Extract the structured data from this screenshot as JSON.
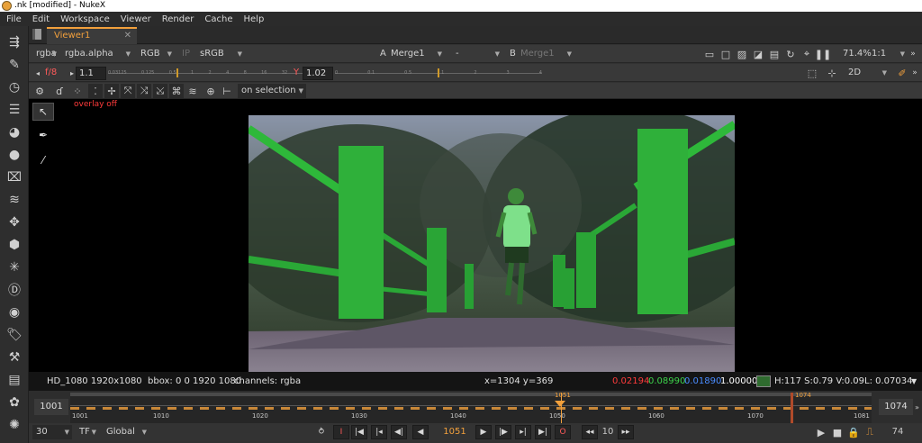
{
  "window": {
    "title": ".nk [modified] - NukeX"
  },
  "menu": [
    "File",
    "Edit",
    "Workspace",
    "Viewer",
    "Render",
    "Cache",
    "Help"
  ],
  "tab": {
    "label": "Viewer1",
    "close": "✕"
  },
  "toolbar1": {
    "channels": "rgba",
    "alpha": "rgba.alpha",
    "display": "RGB",
    "ip": "IP",
    "lut": "sRGB",
    "a_label": "A",
    "a_input": "Merge1",
    "wipe": "-",
    "b_label": "B",
    "b_input": "Merge1",
    "zoom": "71.4%",
    "proxy": "1:1"
  },
  "toolbar2": {
    "fstop": "f/8",
    "gain": "1.1",
    "gain_ticks": [
      "0.03125",
      "0.125",
      "0.5",
      "1",
      "2",
      "4",
      "8",
      "16",
      "32",
      "64"
    ],
    "y_label": "Y",
    "gamma": "1.02",
    "gamma_ticks": [
      "0",
      "0.1",
      "0.5",
      "1",
      "2",
      "3",
      "4"
    ],
    "view_mode": "2D"
  },
  "toolbar3": {
    "selection_mode": "on selection"
  },
  "viewer": {
    "overlay_label": "overlay off"
  },
  "info": {
    "format": "HD_1080 1920x1080",
    "bbox": "bbox: 0 0 1920 1080",
    "channels": "channels: rgba",
    "coords": "x=1304 y=369",
    "r": "0.02194",
    "g": "0.08990",
    "b": "0.01890",
    "a": "1.00000",
    "swatch_color": "#2f6b2f",
    "hsv": "H:117 S:0.79 V:0.09",
    "luminance": "L: 0.07034"
  },
  "timeline": {
    "in_frame": "1001",
    "out_frame": "1074",
    "current": "1051",
    "marker_right": "1074",
    "start_label": "1001",
    "end_label": "1081",
    "ticks": [
      "1010",
      "1020",
      "1030",
      "1040",
      "1050",
      "1060",
      "1070"
    ]
  },
  "playback": {
    "fps": "30",
    "tf": "TF",
    "scope": "Global",
    "frame": "1051",
    "step": "10",
    "end_frame": "74"
  },
  "colors": {
    "accent": "#f2a03c",
    "red": "#ff3b3b",
    "green": "#3cd24a",
    "blue": "#4a8cff"
  }
}
